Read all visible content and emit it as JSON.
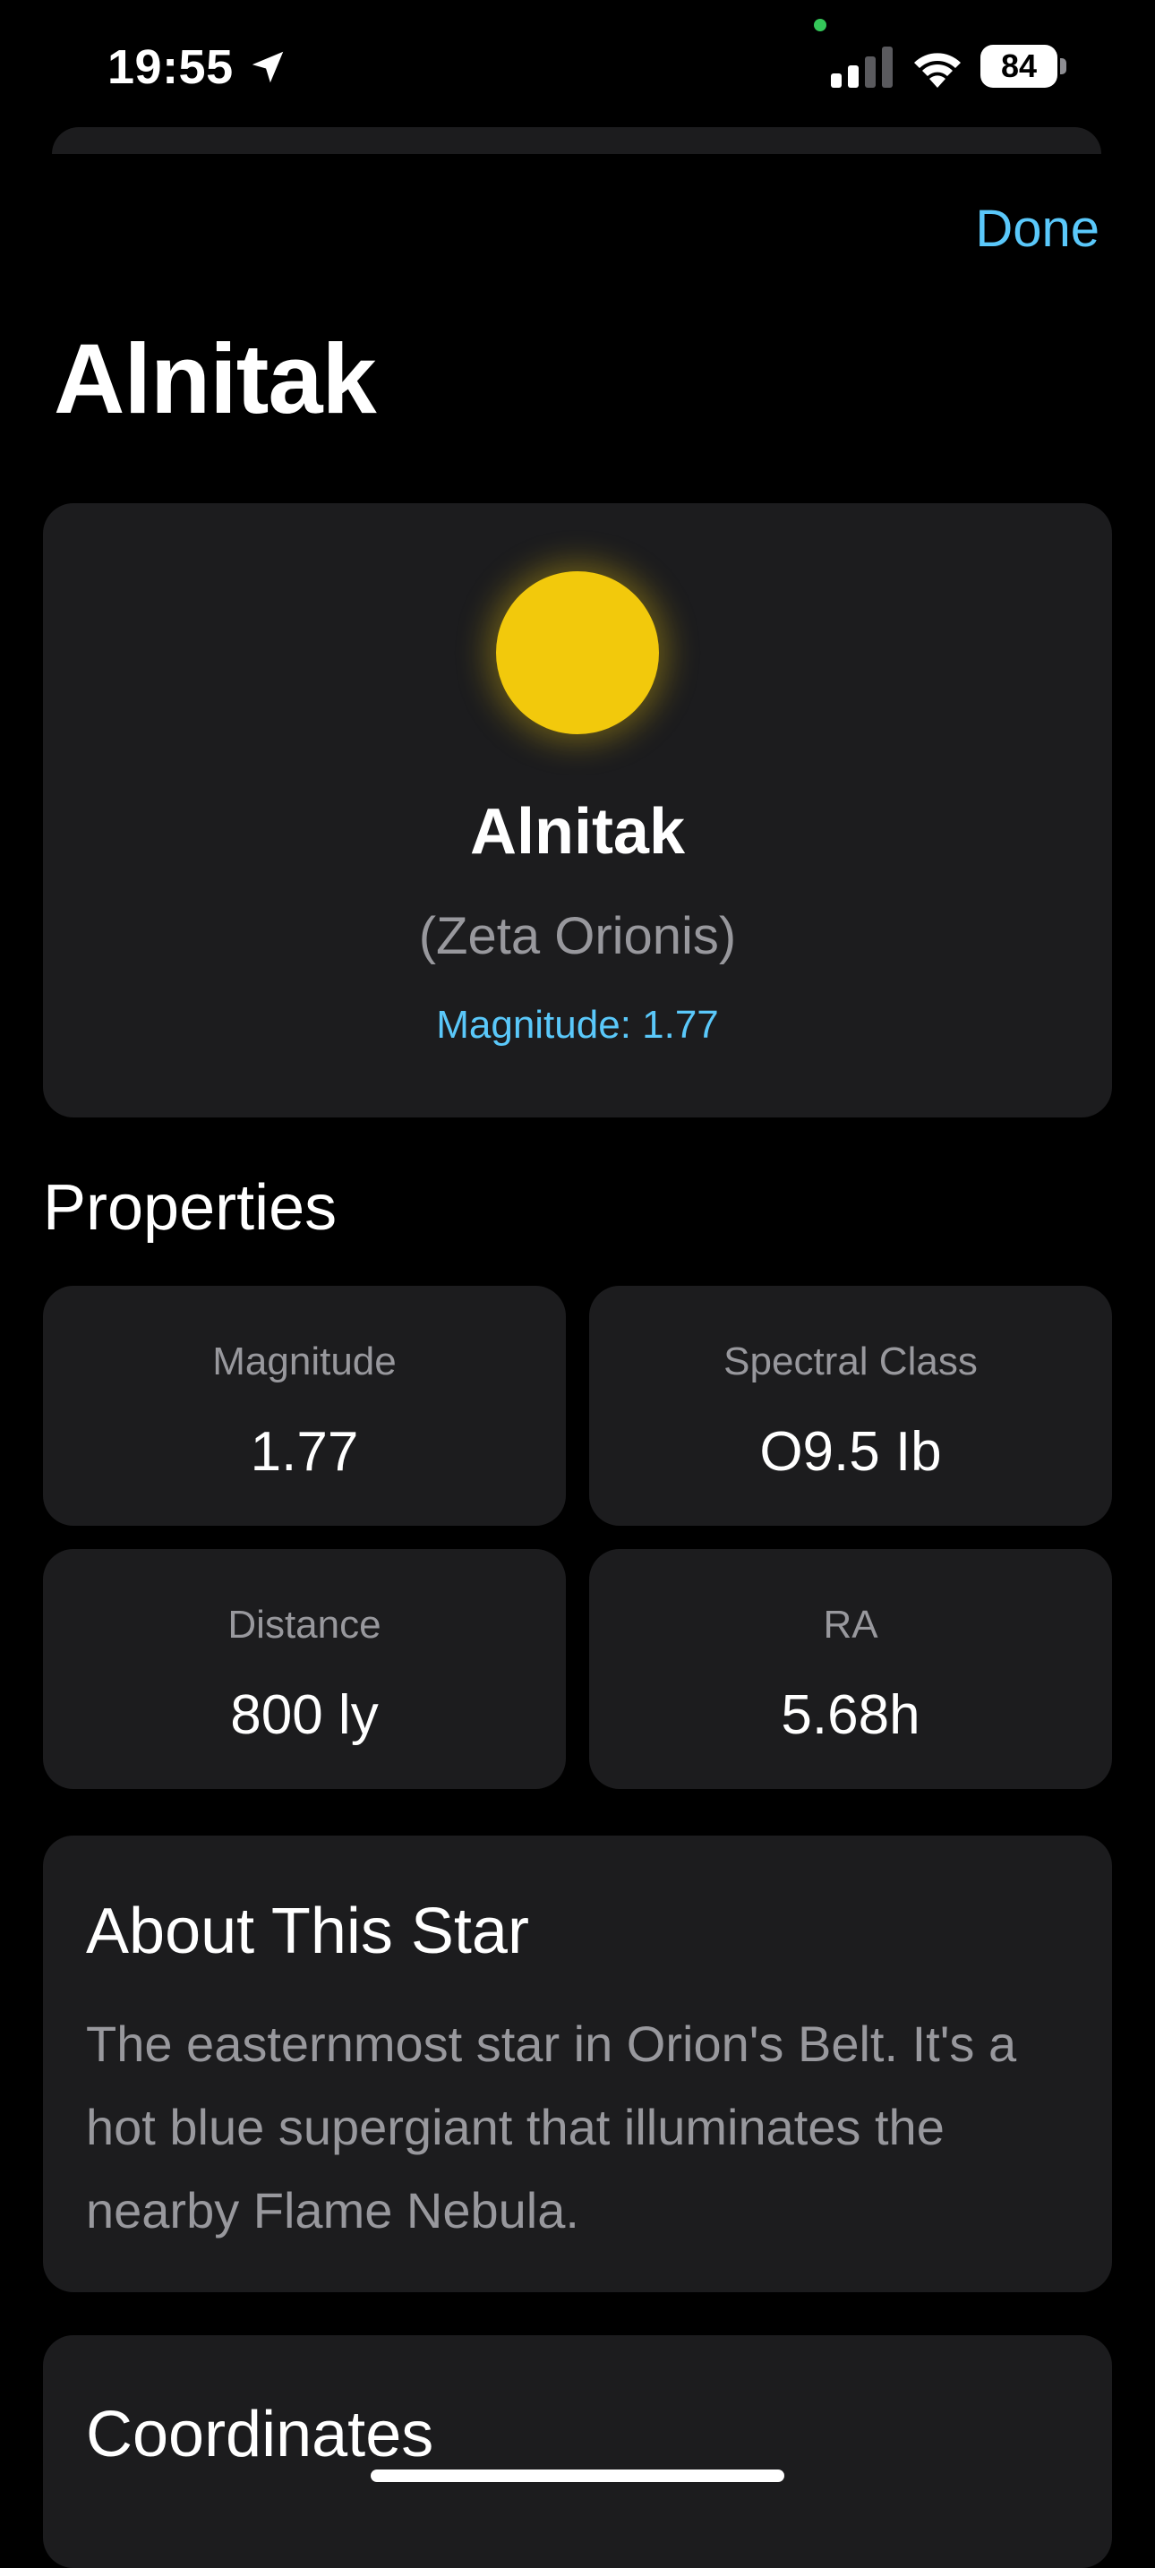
{
  "status_bar": {
    "time": "19:55",
    "battery": "84",
    "icons": [
      "location-arrow-icon",
      "cellular-signal-icon",
      "wifi-icon",
      "battery-icon"
    ]
  },
  "header": {
    "done_label": "Done",
    "title": "Alnitak"
  },
  "hero": {
    "name": "Alnitak",
    "alt_name": "(Zeta Orionis)",
    "magnitude_text": "Magnitude: 1.77",
    "orb_color": "#f2c90c"
  },
  "properties": {
    "title": "Properties",
    "items": [
      {
        "label": "Magnitude",
        "value": "1.77"
      },
      {
        "label": "Spectral Class",
        "value": "O9.5 Ib"
      },
      {
        "label": "Distance",
        "value": "800 ly"
      },
      {
        "label": "RA",
        "value": "5.68h"
      }
    ]
  },
  "about": {
    "title": "About This Star",
    "text": "The easternmost star in Orion's Belt. It's a hot blue supergiant that illuminates the nearby Flame Nebula."
  },
  "coordinates": {
    "title": "Coordinates"
  },
  "colors": {
    "accent": "#5ac8fa",
    "background": "#000000",
    "card": "#1c1c1e",
    "secondary_text": "#98989d"
  }
}
